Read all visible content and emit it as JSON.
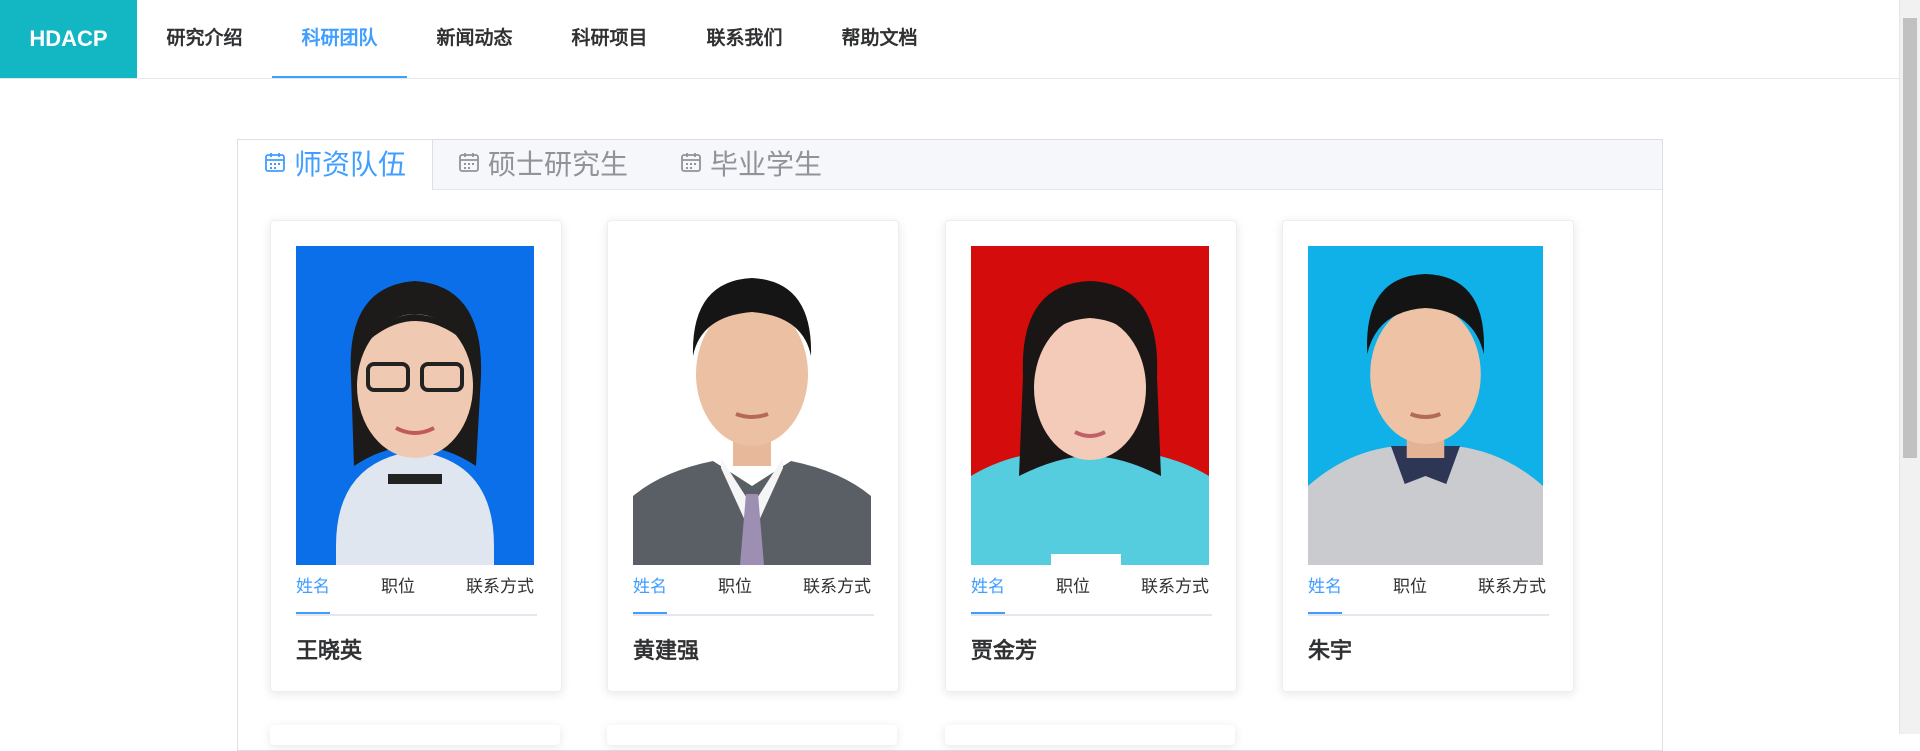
{
  "brand": "HDACP",
  "nav": [
    "研究介绍",
    "科研团队",
    "新闻动态",
    "科研项目",
    "联系我们",
    "帮助文档"
  ],
  "tabs": [
    "师资队伍",
    "硕士研究生",
    "毕业学生"
  ],
  "info_tabs": [
    "姓名",
    "职位",
    "联系方式"
  ],
  "people": [
    {
      "name": "王晓英",
      "bg": "#0a6fe8"
    },
    {
      "name": "黄建强",
      "bg": "#ffffff"
    },
    {
      "name": "贾金芳",
      "bg": "#d40c0c"
    },
    {
      "name": "朱宇",
      "bg": "#10b1e9"
    }
  ],
  "colors": {
    "accent": "#409eff",
    "brand": "#13b6c3"
  }
}
